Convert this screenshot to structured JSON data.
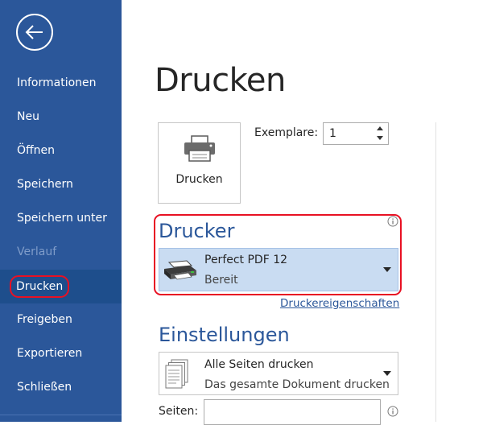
{
  "sidebar": {
    "items": [
      {
        "label": "Informationen"
      },
      {
        "label": "Neu"
      },
      {
        "label": "Öffnen"
      },
      {
        "label": "Speichern"
      },
      {
        "label": "Speichern unter"
      },
      {
        "label": "Verlauf"
      },
      {
        "label": "Drucken"
      },
      {
        "label": "Freigeben"
      },
      {
        "label": "Exportieren"
      },
      {
        "label": "Schließen"
      }
    ],
    "back_icon": "arrow-left-circle-icon"
  },
  "main": {
    "title": "Drucken",
    "print_button": {
      "label": "Drucken",
      "icon": "printer-icon"
    },
    "copies": {
      "label": "Exemplare:",
      "value": "1"
    },
    "printer": {
      "heading": "Drucker",
      "name": "Perfect PDF 12",
      "status": "Bereit",
      "properties_link": "Druckereigenschaften"
    },
    "settings": {
      "heading": "Einstellungen",
      "pages_option": "Alle Seiten drucken",
      "pages_option_desc": "Das gesamte Dokument drucken",
      "pages_label": "Seiten:",
      "pages_value": ""
    }
  },
  "colors": {
    "sidebar_bg": "#2b579a",
    "sidebar_active": "#1e4e8c",
    "accent": "#2b579a",
    "highlight_outline": "#e81123",
    "printer_select_bg": "#c9dcf2"
  }
}
